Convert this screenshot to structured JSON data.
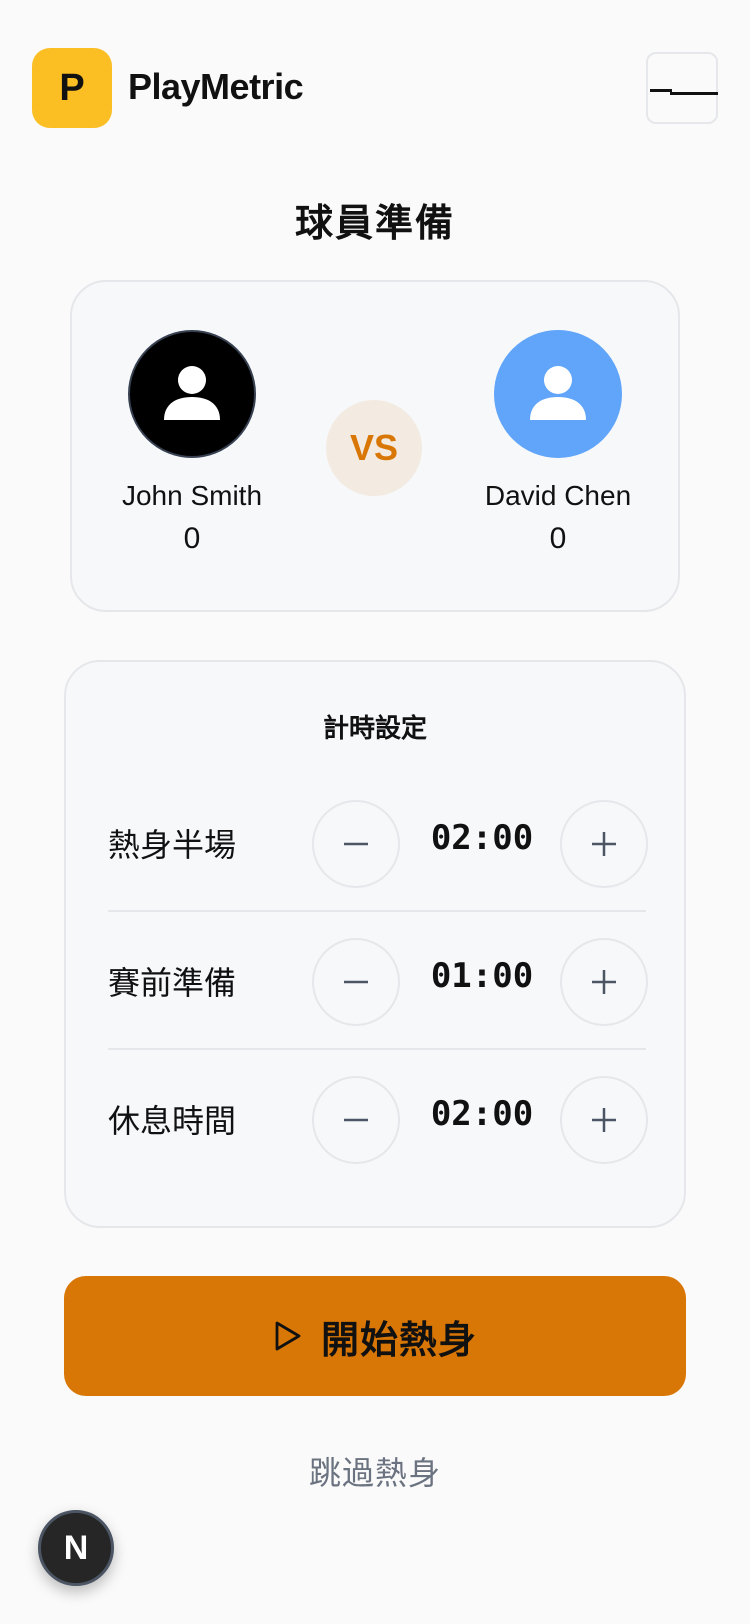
{
  "header": {
    "logo_letter": "P",
    "brand": "PlayMetric",
    "menu_icon": "hamburger-menu-icon"
  },
  "page_title": "球員準備",
  "players": [
    {
      "name": "John Smith",
      "score": "0",
      "avatar_color": "#000000",
      "avatar_icon": "user-icon"
    },
    {
      "name": "David Chen",
      "score": "0",
      "avatar_color": "#60a5fa",
      "avatar_icon": "user-icon"
    }
  ],
  "vs_label": "VS",
  "timer": {
    "title": "計時設定",
    "rows": [
      {
        "label": "熱身半場",
        "value": "02:00"
      },
      {
        "label": "賽前準備",
        "value": "01:00"
      },
      {
        "label": "休息時間",
        "value": "02:00"
      }
    ]
  },
  "start_button": {
    "label": "開始熱身",
    "icon": "play-icon"
  },
  "skip_label": "跳過熱身",
  "badge_letter": "N",
  "colors": {
    "accent": "#d97706",
    "logo_bg": "#fbbf24",
    "vs_bg": "#f3ebe1",
    "muted_text": "#6b7280"
  }
}
